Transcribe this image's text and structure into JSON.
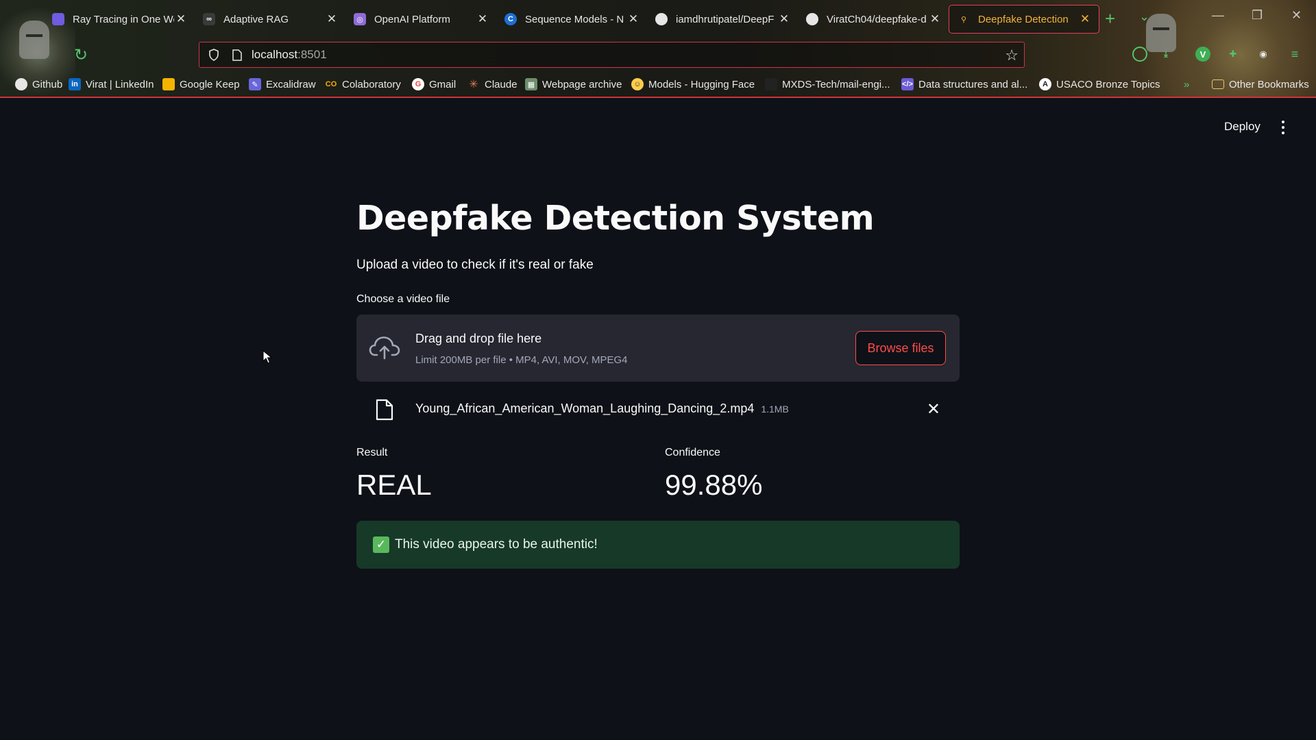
{
  "browser": {
    "tabs": [
      {
        "title": "Ray Tracing in One We",
        "favicon_color": "#6f5ce0"
      },
      {
        "title": "Adaptive RAG",
        "favicon_color": "#3a3a3a"
      },
      {
        "title": "OpenAI Platform",
        "favicon_color": "#8e6bd6"
      },
      {
        "title": "Sequence Models - N",
        "favicon_color": "#1f6fd1"
      },
      {
        "title": "iamdhrutipatel/DeepF",
        "favicon_color": "#e6e6e6"
      },
      {
        "title": "ViratCh04/deepfake-d",
        "favicon_color": "#e6e6e6"
      },
      {
        "title": "Deepfake Detection",
        "favicon_color": "#f2b23a",
        "active": true
      }
    ],
    "url_host": "localhost",
    "url_port": ":8501",
    "bookmarks": [
      {
        "label": "Github",
        "icon_color": "#e6e6e6"
      },
      {
        "label": "Virat | LinkedIn",
        "icon_color": "#0a66c2",
        "icon_text": "in"
      },
      {
        "label": "Google Keep",
        "icon_color": "#f5b400"
      },
      {
        "label": "Excalidraw",
        "icon_color": "#6965db"
      },
      {
        "label": "Colaboratory",
        "icon_color": "#f9ab00",
        "icon_text": "CO"
      },
      {
        "label": "Gmail",
        "icon_color": "#ea4335",
        "icon_text": "G"
      },
      {
        "label": "Claude",
        "icon_color": "#d97757"
      },
      {
        "label": "Webpage archive",
        "icon_color": "#6b8f6b"
      },
      {
        "label": "Models - Hugging Face",
        "icon_color": "#ffcc4d"
      },
      {
        "label": "MXDS-Tech/mail-engi...",
        "icon_color": "#222222"
      },
      {
        "label": "Data structures and al...",
        "icon_color": "#6b5bd6"
      },
      {
        "label": "USACO Bronze Topics",
        "icon_color": "#ffffff"
      },
      {
        "label": "Other Bookmarks",
        "icon_color": "#e6c66a"
      }
    ]
  },
  "app": {
    "deploy_label": "Deploy",
    "title": "Deepfake Detection System",
    "subtitle": "Upload a video to check if it's real or fake",
    "uploader": {
      "label": "Choose a video file",
      "drop_text": "Drag and drop file here",
      "limit_text": "Limit 200MB per file • MP4, AVI, MOV, MPEG4",
      "browse_label": "Browse files"
    },
    "uploaded_file": {
      "name": "Young_African_American_Woman_Laughing_Dancing_2.mp4",
      "size": "1.1MB"
    },
    "metrics": [
      {
        "label": "Result",
        "value": "REAL"
      },
      {
        "label": "Confidence",
        "value": "99.88%"
      }
    ],
    "alert": {
      "text": "This video appears to be authentic!",
      "color": "#173928"
    },
    "colors": {
      "background": "#0e1117",
      "accent": "#ff4b4b",
      "panel": "#262730"
    }
  }
}
